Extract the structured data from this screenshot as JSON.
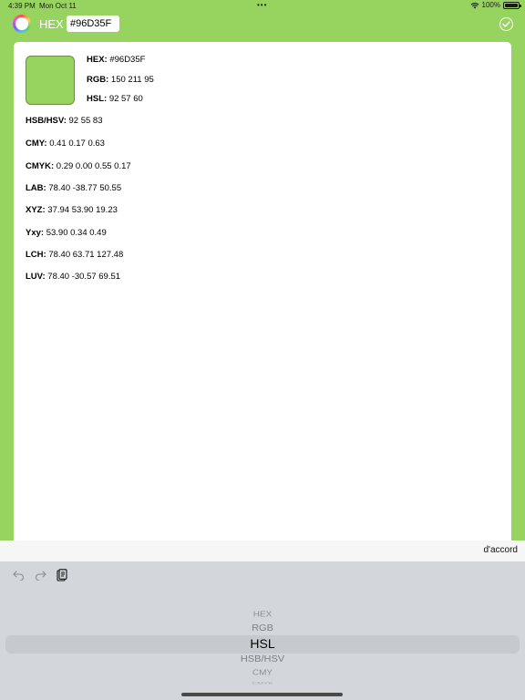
{
  "status_bar": {
    "time": "4:39 PM",
    "date": "Mon Oct 11",
    "dots": "•••",
    "battery_percent": "100%",
    "icons": [
      "wifi-icon",
      "battery-icon"
    ]
  },
  "top_bar": {
    "app_icon": "color-wheel-icon",
    "format_label": "HEX",
    "hex_value": "#96D35F",
    "confirm_icon": "checkmark-circle-icon"
  },
  "colors": {
    "background": "#96D35F",
    "swatch": "#96D35F",
    "card": "#FFFFFF"
  },
  "values": {
    "hex": {
      "key": "HEX:",
      "value": "#96D35F"
    },
    "rgb": {
      "key": "RGB:",
      "value": "150  211  95"
    },
    "hsl": {
      "key": "HSL:",
      "value": "92  57  60"
    },
    "hsb": {
      "key": "HSB/HSV:",
      "value": "92  55  83"
    },
    "cmy": {
      "key": "CMY:",
      "value": "0.41  0.17  0.63"
    },
    "cmyk": {
      "key": "CMYK:",
      "value": "0.29  0.00  0.55  0.17"
    },
    "lab": {
      "key": "LAB:",
      "value": "78.40  -38.77  50.55"
    },
    "xyz": {
      "key": "XYZ:",
      "value": "37.94  53.90  19.23"
    },
    "yxy": {
      "key": "Yxy:",
      "value": "53.90  0.34  0.49"
    },
    "lch": {
      "key": "LCH:",
      "value": "78.40  63.71  127.48"
    },
    "luv": {
      "key": "LUV:",
      "value": "78.40  -30.57  69.51"
    }
  },
  "keyboard": {
    "done_label": "d'accord",
    "toolbar_icons": [
      "undo-icon",
      "redo-icon",
      "paste-icon"
    ],
    "picker_options": [
      "HEX",
      "RGB",
      "HSL",
      "HSB/HSV",
      "CMY",
      "CMYK"
    ],
    "picker_selected": "HSL"
  }
}
